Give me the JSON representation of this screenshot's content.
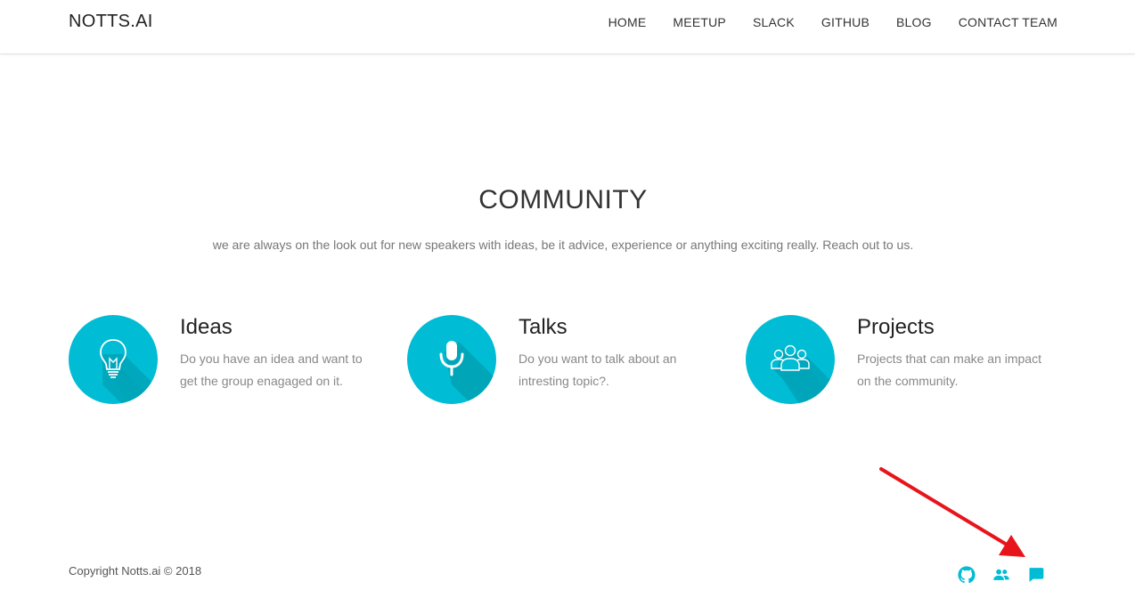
{
  "brand": "NOTTS.AI",
  "nav": {
    "items": [
      {
        "label": "HOME"
      },
      {
        "label": "MEETUP"
      },
      {
        "label": "SLACK"
      },
      {
        "label": "GITHUB"
      },
      {
        "label": "BLOG"
      },
      {
        "label": "CONTACT TEAM"
      }
    ]
  },
  "community": {
    "title": "COMMUNITY",
    "subtitle": "we are always on the look out for new speakers with ideas, be it advice, experience or anything exciting really. Reach out to us."
  },
  "features": [
    {
      "title": "Ideas",
      "text": "Do you have an idea and want to get the group enagaged on it.",
      "icon": "lightbulb-icon"
    },
    {
      "title": "Talks",
      "text": "Do you want to talk about an intresting topic?.",
      "icon": "microphone-icon"
    },
    {
      "title": "Projects",
      "text": "Projects that can make an impact on the community.",
      "icon": "group-icon"
    }
  ],
  "footer": {
    "copyright": "Copyright Notts.ai © 2018",
    "icons": [
      "github-icon",
      "people-icon",
      "chat-icon"
    ]
  },
  "colors": {
    "accent": "#00bcd4",
    "accent_shadow": "#00a5b8",
    "annotation": "#e8141b"
  }
}
